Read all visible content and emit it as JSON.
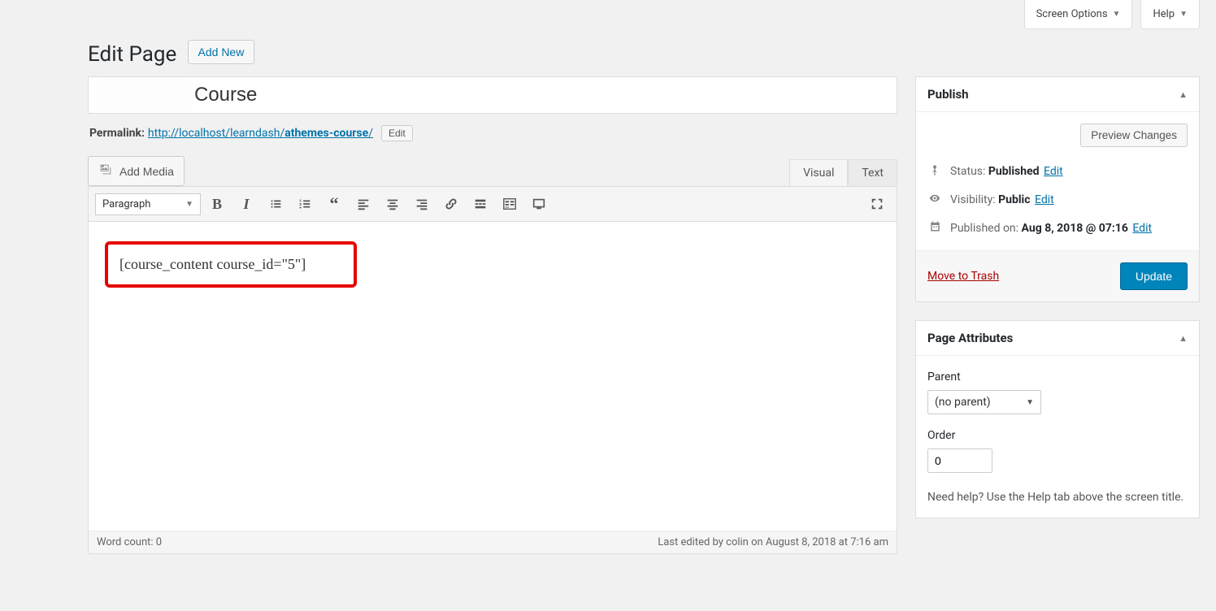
{
  "topTabs": {
    "screenOptions": "Screen Options",
    "help": "Help"
  },
  "header": {
    "title": "Edit Page",
    "addNew": "Add New"
  },
  "post": {
    "titleVisible": "Course",
    "permalinkLabel": "Permalink:",
    "permalinkBase": "http://localhost/learndash/",
    "permalinkSlug": "athemes-course",
    "permalinkTrail": "/",
    "editBtn": "Edit"
  },
  "editor": {
    "addMedia": "Add Media",
    "visualTab": "Visual",
    "textTab": "Text",
    "paragraphLabel": "Paragraph",
    "content": "[course_content course_id=\"5\"]",
    "wordCountLabel": "Word count:",
    "wordCount": "0",
    "lastEdited": "Last edited by colin on August 8, 2018 at 7:16 am"
  },
  "publish": {
    "boxTitle": "Publish",
    "preview": "Preview Changes",
    "statusLabel": "Status:",
    "statusValue": "Published",
    "visibilityLabel": "Visibility:",
    "visibilityValue": "Public",
    "publishedOnLabel": "Published on:",
    "publishedOnValue": "Aug 8, 2018 @ 07:16",
    "editLink": "Edit",
    "trash": "Move to Trash",
    "update": "Update"
  },
  "attrs": {
    "boxTitle": "Page Attributes",
    "parentLabel": "Parent",
    "parentValue": "(no parent)",
    "orderLabel": "Order",
    "orderValue": "0",
    "helpText": "Need help? Use the Help tab above the screen title."
  }
}
